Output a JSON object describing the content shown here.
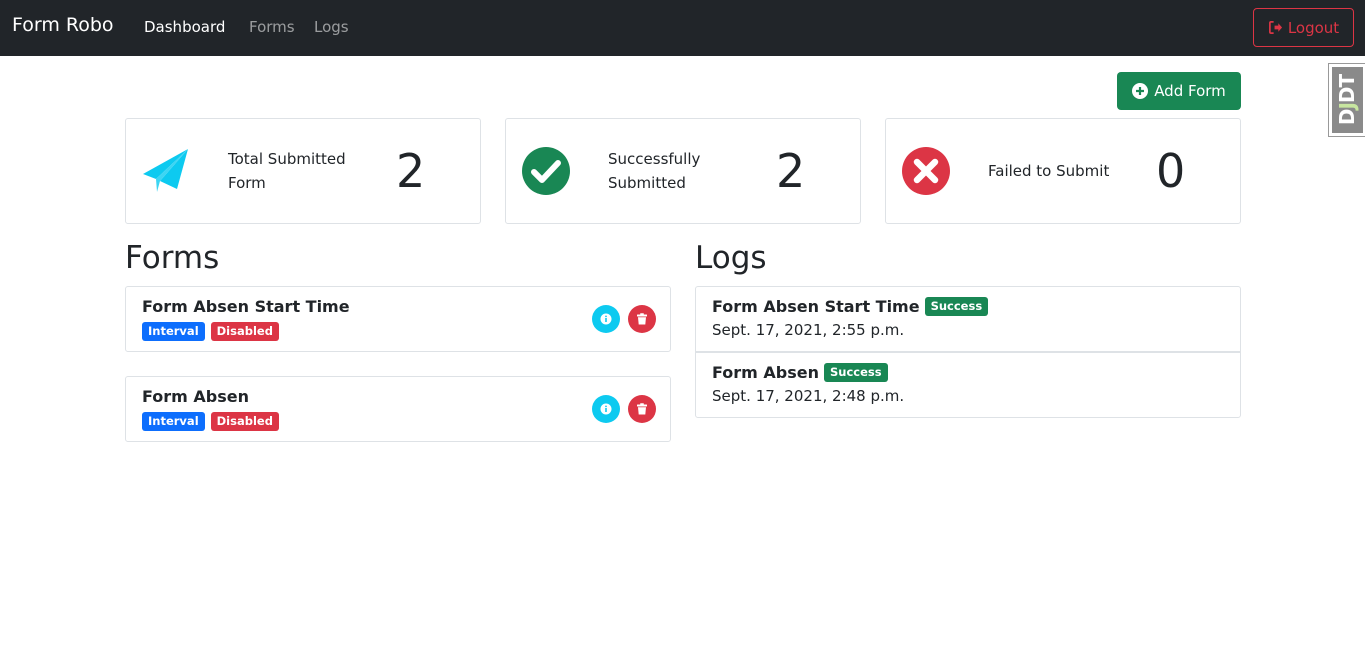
{
  "navbar": {
    "brand": "Form Robo",
    "links": [
      "Dashboard",
      "Forms",
      "Logs"
    ],
    "active": "Dashboard",
    "logout_label": "Logout"
  },
  "debug_toolbar": {
    "label_d": "D",
    "label_j": "J",
    "label_dt": "DT"
  },
  "actions": {
    "add_form_label": "Add Form"
  },
  "stats": [
    {
      "label_line1": "Total Submitted",
      "label_line2": "Form",
      "value": "2",
      "icon": "paper-plane-icon",
      "color": "#0dcaf0"
    },
    {
      "label_line1": "Successfully",
      "label_line2": "Submitted",
      "value": "2",
      "icon": "check-circle-icon",
      "color": "#198754"
    },
    {
      "label_line1": "Failed to Submit",
      "label_line2": "",
      "value": "0",
      "icon": "x-circle-icon",
      "color": "#dc3545"
    }
  ],
  "forms_section": {
    "title": "Forms",
    "items": [
      {
        "name": "Form Absen Start Time",
        "badges": [
          "Interval",
          "Disabled"
        ]
      },
      {
        "name": "Form Absen",
        "badges": [
          "Interval",
          "Disabled"
        ]
      }
    ]
  },
  "logs_section": {
    "title": "Logs",
    "items": [
      {
        "name": "Form Absen Start Time",
        "status": "Success",
        "date": "Sept. 17, 2021, 2:55 p.m."
      },
      {
        "name": "Form Absen",
        "status": "Success",
        "date": "Sept. 17, 2021, 2:48 p.m."
      }
    ]
  }
}
